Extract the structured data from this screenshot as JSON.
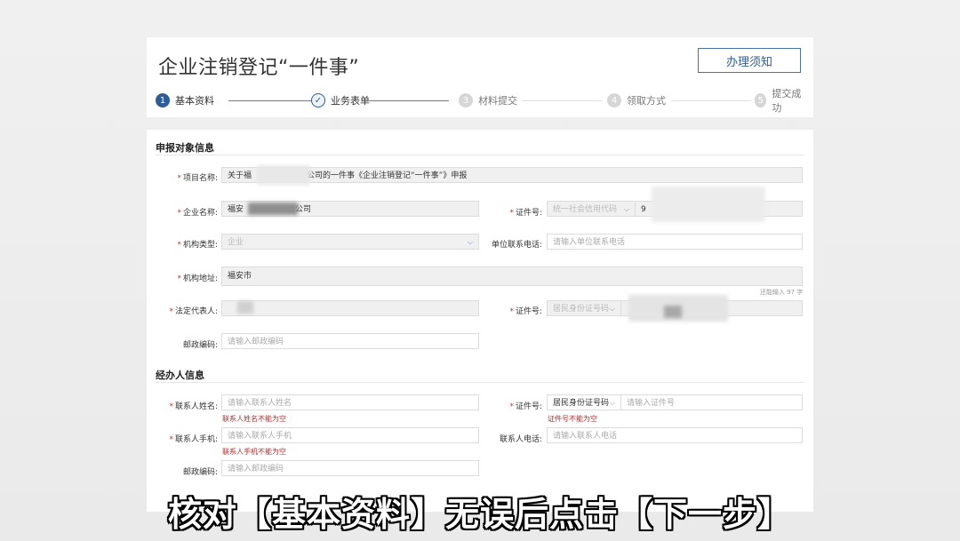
{
  "header": {
    "title": "企业注销登记“一件事”",
    "notice_button": "办理须知"
  },
  "steps": [
    {
      "num": "1",
      "label": "基本资料",
      "state": "active"
    },
    {
      "num": "✓",
      "label": "业务表单",
      "state": "done"
    },
    {
      "num": "3",
      "label": "材料提交",
      "state": "todo"
    },
    {
      "num": "4",
      "label": "领取方式",
      "state": "todo"
    },
    {
      "num": "5",
      "label": "提交成功",
      "state": "todo"
    }
  ],
  "section1": {
    "title": "申报对象信息",
    "project_name_label": "项目名称:",
    "project_name_prefix": "关于福",
    "project_name_suffix": "公司的一件事《企业注销登记“一件事”》申报",
    "company_name_label": "企业名称:",
    "company_name_prefix": "福安",
    "company_name_suffix": "公司",
    "cert_label": "证件号:",
    "cert_type": "统一社会信用代码",
    "cert_value_prefix": "9",
    "org_type_label": "机构类型:",
    "org_type_value": "企业",
    "unit_phone_label": "单位联系电话:",
    "unit_phone_placeholder": "请输入单位联系电话",
    "org_address_label": "机构地址:",
    "org_address_value": "福安市",
    "address_counter": "还能输入 97 字",
    "legal_rep_label": "法定代表人:",
    "legal_cert_label": "证件号:",
    "legal_cert_type": "居民身份证号码",
    "postcode_label": "邮政编码:",
    "postcode_placeholder": "请输入邮政编码"
  },
  "section2": {
    "title": "经办人信息",
    "contact_name_label": "联系人姓名:",
    "contact_name_placeholder": "请输入联系人姓名",
    "contact_name_error": "联系人姓名不能为空",
    "cert_label": "证件号:",
    "cert_type": "居民身份证号码",
    "cert_placeholder": "请输入证件号",
    "cert_error": "证件号不能为空",
    "mobile_label": "联系人手机:",
    "mobile_placeholder": "请输入联系人手机",
    "mobile_error": "联系人手机不能为空",
    "phone_label": "联系人电话:",
    "phone_placeholder": "请输入联系人电话",
    "postcode_label": "邮政编码:",
    "postcode_placeholder": "请输入邮政编码"
  },
  "caption": "核对【基本资料】无误后点击【下一步】",
  "colors": {
    "accent": "#2e5c99",
    "error": "#b03030"
  }
}
